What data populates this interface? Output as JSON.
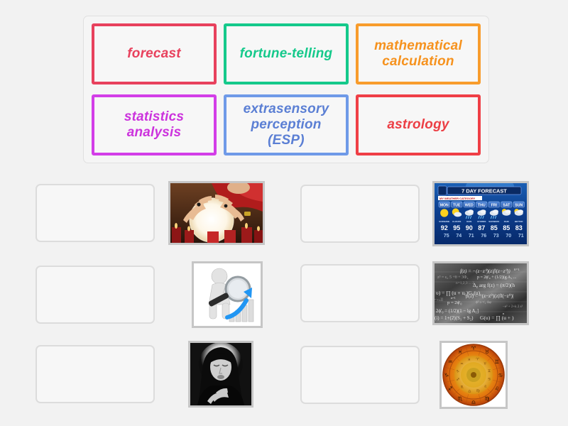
{
  "activity": {
    "type": "match-up",
    "background_color": "#f2f2f2"
  },
  "word_bank": {
    "panel_background": "#f5f5f5",
    "panel_border": "#e0e0e0",
    "cards": [
      {
        "label": "forecast",
        "color": "#e8415d",
        "border_color": "#e8415d",
        "row": 1,
        "col": 1
      },
      {
        "label": "fortune-telling",
        "color": "#15c98b",
        "border_color": "#15c98b",
        "row": 1,
        "col": 2
      },
      {
        "label": "mathematical\ncalculation",
        "color": "#f6921e",
        "border_color": "#f89c2c",
        "row": 1,
        "col": 3
      },
      {
        "label": "statistics\nanalysis",
        "color": "#cc33dd",
        "border_color": "#d33ee8",
        "row": 2,
        "col": 1
      },
      {
        "label": "extrasensory\nperception (ESP)",
        "color": "#5b7fd4",
        "border_color": "#6f9ae8",
        "row": 2,
        "col": 2
      },
      {
        "label": "astrology",
        "color": "#ec3f45",
        "border_color": "#ef3f46",
        "row": 2,
        "col": 3
      }
    ]
  },
  "answers": {
    "drop_box_border": "#dcdcdc",
    "thumb_border": "#c6c6c6",
    "pairs": [
      {
        "id": "pair-1",
        "drop_value": "",
        "image_name": "crystal-ball-fortune-teller-image",
        "image_alt": "Hands over a glowing crystal ball surrounded by red candles"
      },
      {
        "id": "pair-2",
        "drop_value": "",
        "image_name": "statistics-analysis-image",
        "image_alt": "3D white figure with magnifying glass over a rising bar chart with blue arrow"
      },
      {
        "id": "pair-3",
        "drop_value": "",
        "image_name": "psychic-woman-esp-image",
        "image_alt": "Black and white photo of an elderly woman in a dark headscarf with a glowing halo"
      },
      {
        "id": "pair-4",
        "drop_value": "",
        "image_name": "seven-day-weather-forecast-image",
        "image_alt": "Blue TV 7 day weather forecast graphic"
      },
      {
        "id": "pair-5",
        "drop_value": "",
        "image_name": "mathematical-formulas-blackboard-image",
        "image_alt": "Grayscale blackboard covered in mathematical formulas"
      },
      {
        "id": "pair-6",
        "drop_value": "",
        "image_name": "zodiac-wheel-astrology-image",
        "image_alt": "Orange zodiac wheel with the twelve astrological signs"
      }
    ]
  },
  "forecast_image": {
    "title": "7 DAY FORECAST",
    "subtitle": "MY WEATHER CATEGORY",
    "days": [
      "MON",
      "TUE",
      "WED",
      "THU",
      "FRI",
      "SAT",
      "SUN"
    ],
    "conditions": [
      "SUNSHINE",
      "CLOUDS",
      "RAIN",
      "STORMS",
      "SHOWERS",
      "RAIN",
      "BETTER"
    ],
    "highs": [
      92,
      95,
      90,
      87,
      85,
      85,
      83
    ],
    "lows": [
      75,
      74,
      71,
      76,
      73,
      70,
      71
    ]
  }
}
